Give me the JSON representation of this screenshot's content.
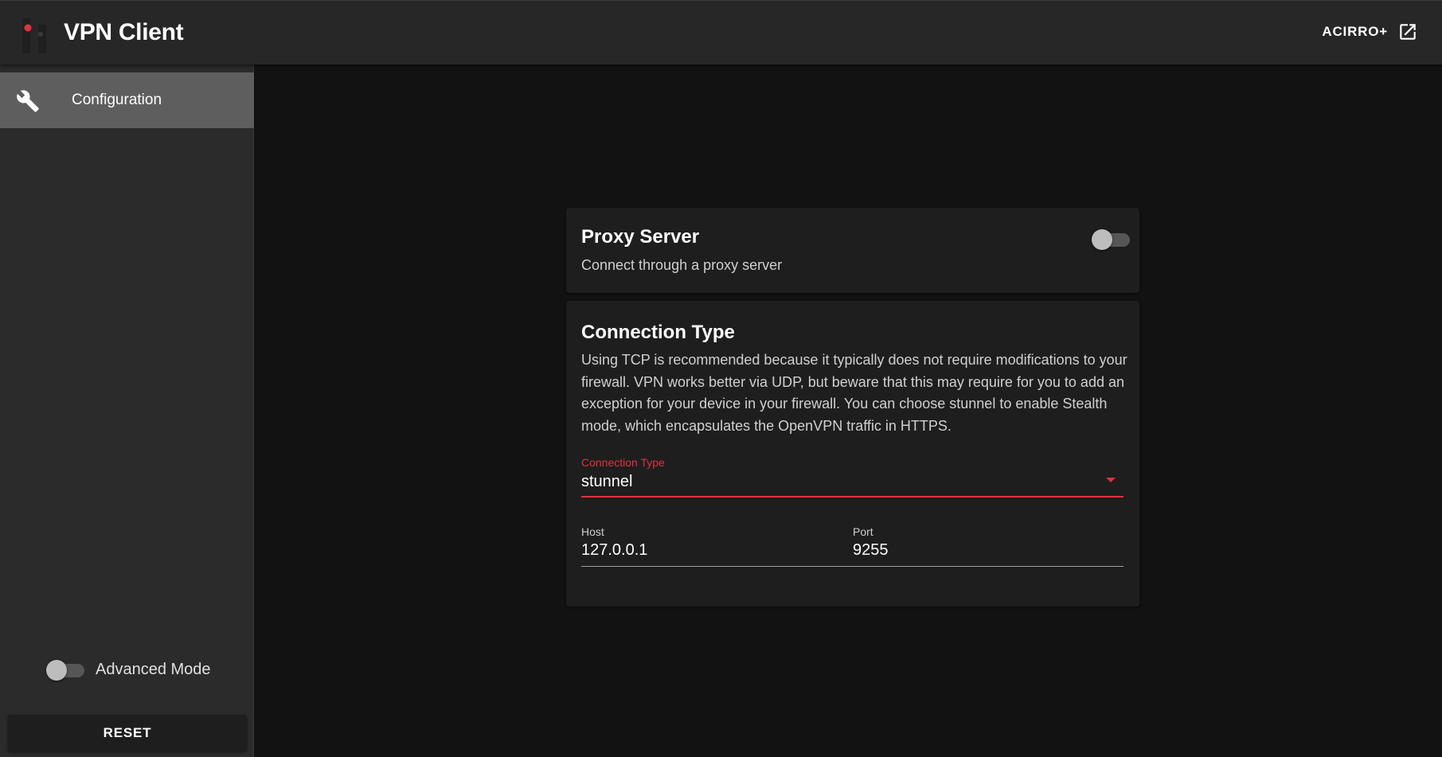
{
  "app": {
    "title": "VPN Client",
    "logo_icon": "brand-logo-icon"
  },
  "header": {
    "link_label": "ACIRRO+",
    "link_icon": "open-in-new-icon"
  },
  "sidebar": {
    "items": [
      {
        "label": "Configuration",
        "icon": "wrench-icon",
        "active": true
      }
    ],
    "advanced_mode": {
      "label": "Advanced Mode",
      "enabled": false
    },
    "reset_label": "RESET"
  },
  "proxy": {
    "title": "Proxy Server",
    "subtitle": "Connect through a proxy server",
    "enabled": false
  },
  "connection": {
    "title": "Connection Type",
    "description": "Using TCP is recommended because it typically does not require modifications to your firewall. VPN works better via UDP, but beware that this may require for you to add an exception for your device in your firewall. You can choose stunnel to enable Stealth mode, which encapsulates the OpenVPN traffic in HTTPS.",
    "type_label": "Connection Type",
    "type_value": "stunnel",
    "host_label": "Host",
    "host_value": "127.0.0.1",
    "port_label": "Port",
    "port_value": "9255"
  },
  "colors": {
    "accent": "#e0333f",
    "appbar": "#272727",
    "sidebar": "#2b2b2b",
    "active_nav": "#5e5e5e",
    "background": "#121212",
    "card": "#1e1e1e"
  }
}
